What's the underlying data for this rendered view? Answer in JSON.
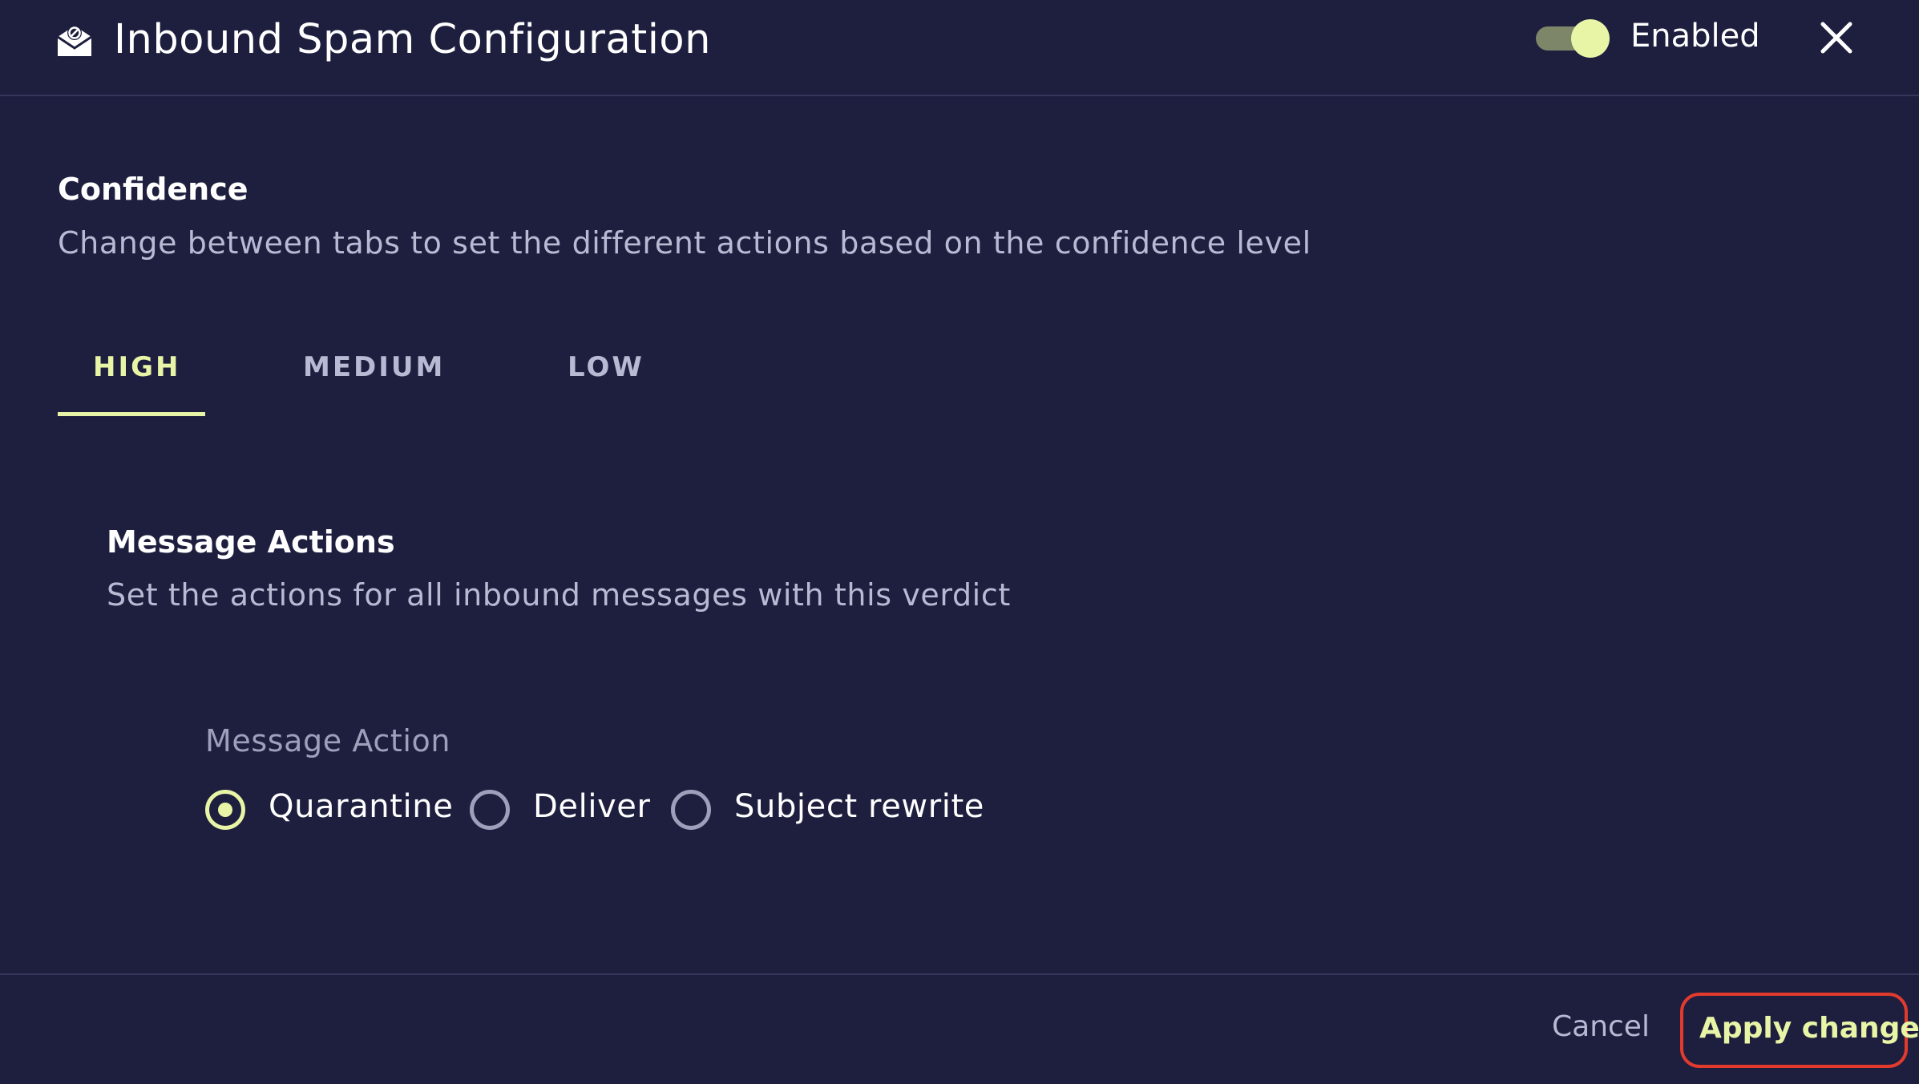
{
  "header": {
    "title": "Inbound Spam Configuration",
    "icon": "spam-envelope-icon",
    "toggle_label": "Enabled",
    "toggle_on": true,
    "close_icon": "close-icon"
  },
  "confidence": {
    "title": "Confidence",
    "description": "Change between tabs to set the different actions based on the confidence level",
    "tabs": [
      {
        "label": "HIGH",
        "active": true
      },
      {
        "label": "MEDIUM",
        "active": false
      },
      {
        "label": "LOW",
        "active": false
      }
    ]
  },
  "message_actions": {
    "title": "Message Actions",
    "description": "Set the actions for all inbound messages with this verdict",
    "field_label": "Message Action",
    "options": [
      {
        "label": "Quarantine",
        "selected": true
      },
      {
        "label": "Deliver",
        "selected": false
      },
      {
        "label": "Subject rewrite",
        "selected": false
      }
    ]
  },
  "footer": {
    "cancel_label": "Cancel",
    "apply_label": "Apply changes"
  },
  "colors": {
    "background": "#1e1f3f",
    "accent": "#e9f5a6",
    "muted_text": "#b8bad3",
    "highlight_border": "#e23b2e"
  }
}
